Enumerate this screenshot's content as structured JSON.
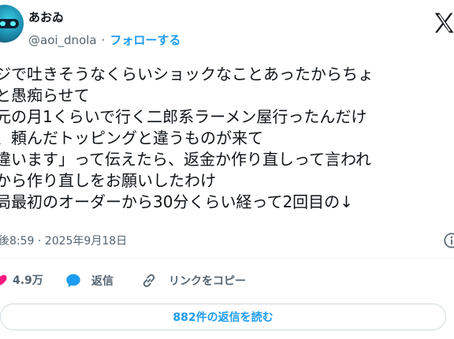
{
  "author": {
    "display_name": "あおゐ",
    "handle": "@aoi_dnola",
    "separator": "·",
    "follow_label": "フォローする"
  },
  "tweet": {
    "lines": [
      "ジで吐きそうなくらいショックなことあったからちょ",
      "と愚痴らせて",
      "元の月1くらいで行く二郎系ラーメン屋行ったんだけ",
      "、頼んだトッピングと違うものが来て",
      "違います」って伝えたら、返金か作り直しって言われ",
      "から作り直しをお願いしたわけ",
      "局最初のオーダーから30分くらい経って2回目の↓"
    ],
    "timestamp": "後8:59 · 2025年9月18日"
  },
  "actions": {
    "likes_count": "4.9万",
    "reply_label": "返信",
    "copy_link_label": "リンクをコピー"
  },
  "read_replies_label": "882件の返信を読む",
  "colors": {
    "accent": "#1d9bf0",
    "like": "#f91880",
    "text": "#0f1419",
    "muted": "#536471"
  },
  "icons": [
    "x-logo",
    "info-icon",
    "heart-icon",
    "reply-bubble-icon",
    "link-icon"
  ]
}
